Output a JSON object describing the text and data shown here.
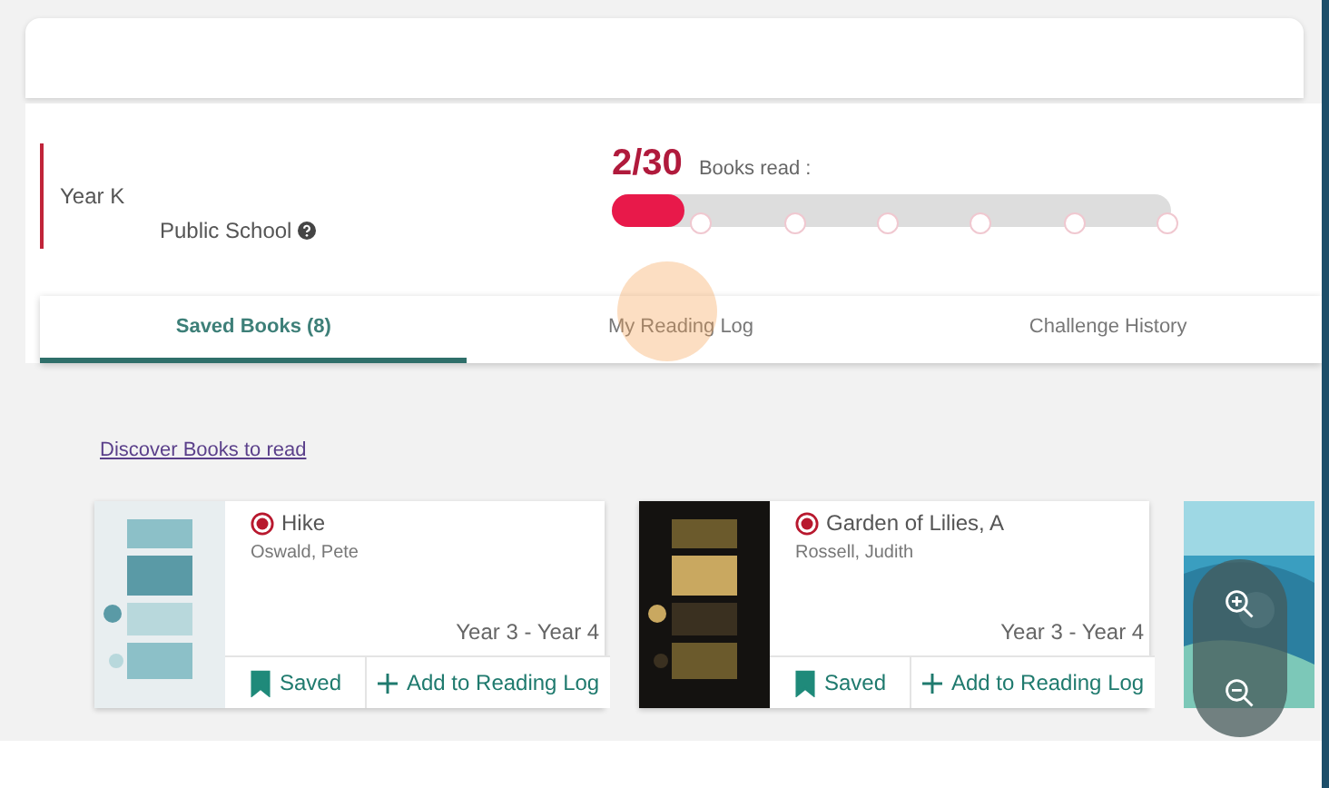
{
  "profile": {
    "year": "Year K",
    "school": "Public School"
  },
  "progress": {
    "count": "2/30",
    "label": "Books read :",
    "level": 0.13
  },
  "tabs": [
    {
      "label": "Saved Books (8)",
      "selected": true
    },
    {
      "label": "My Reading Log",
      "selected": false
    },
    {
      "label": "Challenge History",
      "selected": false
    }
  ],
  "discover_link": "Discover Books to read",
  "books": [
    {
      "kind": "full",
      "title": "Hike",
      "author": "Oswald, Pete",
      "years": "Year 3 - Year 4",
      "saved": true,
      "saved_label": "Saved",
      "add_label": "Add to Reading Log"
    },
    {
      "kind": "full",
      "title": "Garden of Lilies, A",
      "author": "Rossell, Judith",
      "years": "Year 3 - Year 4",
      "saved": true,
      "saved_label": "Saved",
      "add_label": "Add to Reading Log"
    },
    {
      "kind": "cut"
    }
  ]
}
